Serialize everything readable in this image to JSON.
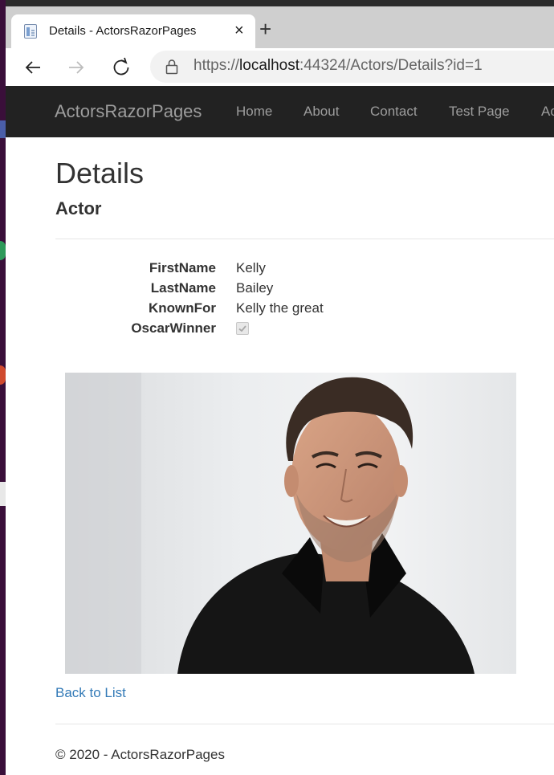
{
  "browser": {
    "tab_title": "Details - ActorsRazorPages",
    "close_glyph": "×",
    "new_tab_glyph": "+",
    "url_scheme": "https://",
    "url_host": "localhost",
    "url_rest": ":44324/Actors/Details?id=1"
  },
  "site_nav": {
    "brand": "ActorsRazorPages",
    "links": [
      "Home",
      "About",
      "Contact",
      "Test Page",
      "Ac"
    ]
  },
  "page": {
    "title": "Details",
    "subtitle": "Actor",
    "fields": [
      {
        "label": "FirstName",
        "value": "Kelly"
      },
      {
        "label": "LastName",
        "value": "Bailey"
      },
      {
        "label": "KnownFor",
        "value": "Kelly the great"
      },
      {
        "label": "OscarWinner",
        "checked": true
      }
    ],
    "back_link": "Back to List",
    "footer": "© 2020 - ActorsRazorPages"
  },
  "colors": {
    "navbar": "#222222",
    "link": "#337ab7"
  }
}
